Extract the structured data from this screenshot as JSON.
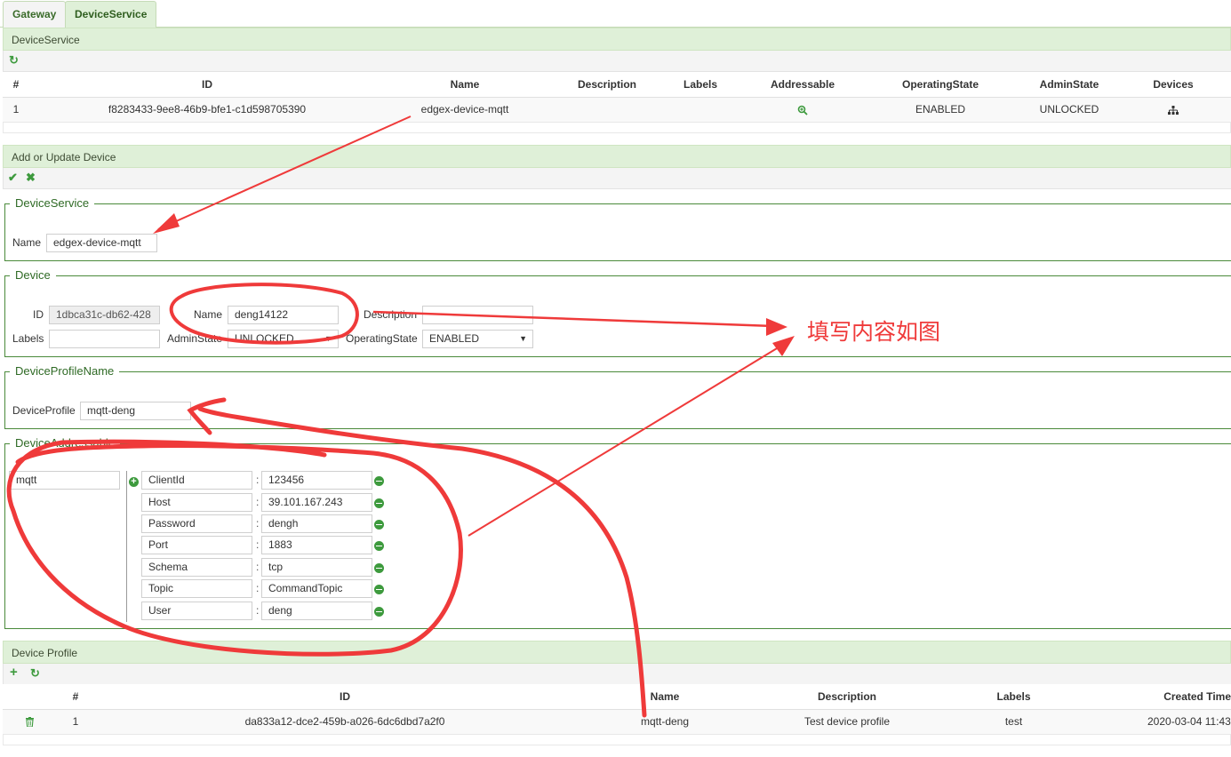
{
  "tabs": [
    {
      "label": "Gateway",
      "active": false
    },
    {
      "label": "DeviceService",
      "active": true
    }
  ],
  "device_service_panel": {
    "title": "DeviceService",
    "toolbar": {
      "refresh_icon": "refresh-icon"
    },
    "columns": [
      "#",
      "ID",
      "Name",
      "Description",
      "Labels",
      "Addressable",
      "OperatingState",
      "AdminState",
      "Devices"
    ],
    "rows": [
      {
        "num": "1",
        "id": "f8283433-9ee8-46b9-bfe1-c1d598705390",
        "name": "edgex-device-mqtt",
        "description": "",
        "labels": "",
        "addressable_icon": "zoom-in-icon",
        "operating_state": "ENABLED",
        "admin_state": "UNLOCKED",
        "devices_icon": "sitemap-icon"
      }
    ]
  },
  "add_update_panel": {
    "title": "Add or Update Device",
    "toolbar": {
      "confirm_icon": "check-icon",
      "cancel_icon": "cross-icon"
    },
    "device_service": {
      "legend": "DeviceService",
      "name_label": "Name",
      "name_value": "edgex-device-mqtt"
    },
    "device": {
      "legend": "Device",
      "id_label": "ID",
      "id_value": "1dbca31c-db62-428",
      "name_label": "Name",
      "name_value": "deng14122",
      "description_label": "Description",
      "description_value": "",
      "labels_label": "Labels",
      "labels_value": "",
      "admin_state_label": "AdminState",
      "admin_state_value": "UNLOCKED",
      "operating_state_label": "OperatingState",
      "operating_state_value": "ENABLED"
    },
    "device_profile_name": {
      "legend": "DeviceProfileName",
      "label": "DeviceProfile",
      "value": "mqtt-deng"
    },
    "device_addressable": {
      "legend": "DeviceAddressable",
      "protocol": "mqtt",
      "properties": [
        {
          "key": "ClientId",
          "value": "123456"
        },
        {
          "key": "Host",
          "value": "39.101.167.243"
        },
        {
          "key": "Password",
          "value": "dengh"
        },
        {
          "key": "Port",
          "value": "1883"
        },
        {
          "key": "Schema",
          "value": "tcp"
        },
        {
          "key": "Topic",
          "value": "CommandTopic"
        },
        {
          "key": "User",
          "value": "deng"
        }
      ]
    }
  },
  "device_profile_panel": {
    "title": "Device Profile",
    "toolbar": {
      "add_icon": "plus-icon",
      "refresh_icon": "refresh-icon"
    },
    "columns": [
      "#",
      "ID",
      "Name",
      "Description",
      "Labels",
      "Created Time"
    ],
    "rows": [
      {
        "delete_icon": "trash-icon",
        "num": "1",
        "id": "da833a12-dce2-459b-a026-6dc6dbd7a2f0",
        "name": "mqtt-deng",
        "description": "Test device profile",
        "labels": "test",
        "created": "2020-03-04 11:43"
      }
    ]
  },
  "annotation": {
    "text": "填写内容如图",
    "color": "#ef3a3a"
  },
  "colors": {
    "panel_header": "#dff0d8",
    "accent_green": "#3d9a3d",
    "fieldset_border": "#4a8a3a",
    "annotation_red": "#ef3a3a"
  }
}
